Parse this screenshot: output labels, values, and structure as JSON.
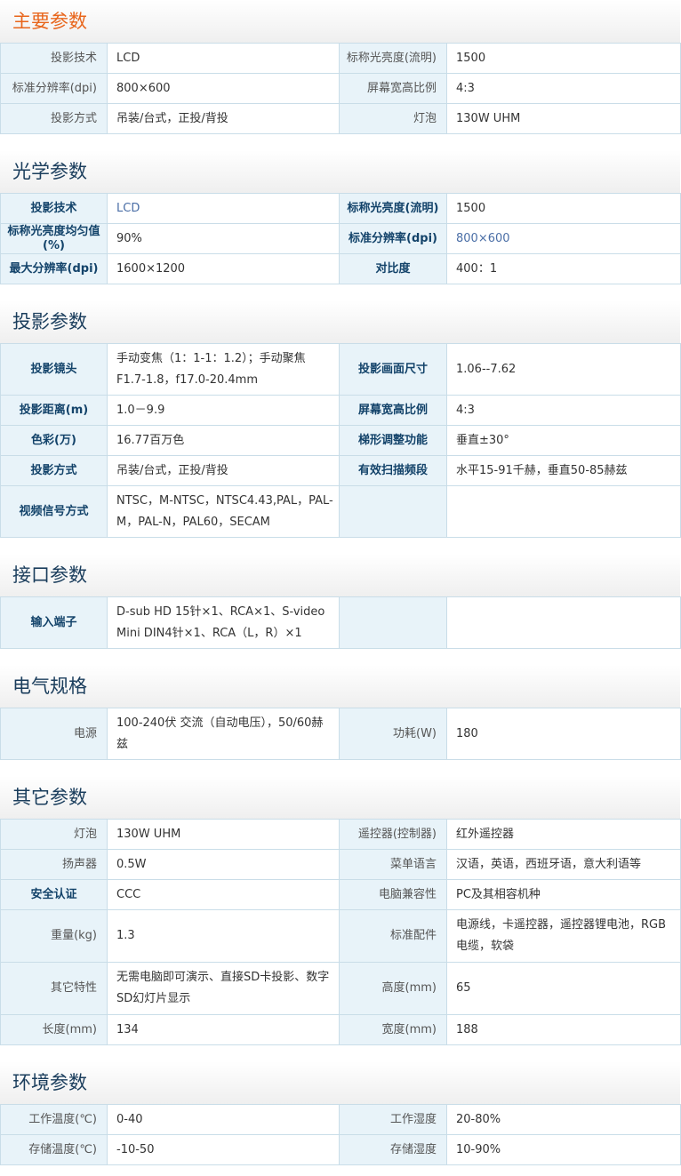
{
  "sections": {
    "main": {
      "title": "主要参数",
      "rows": [
        [
          "投影技术",
          "LCD",
          "标称光亮度(流明)",
          "1500"
        ],
        [
          "标准分辨率(dpi)",
          "800×600",
          "屏幕宽高比例",
          "4:3"
        ],
        [
          "投影方式",
          "吊装/台式，正投/背投",
          "灯泡",
          "130W UHM"
        ]
      ]
    },
    "optics": {
      "title": "光学参数",
      "rows": [
        [
          "投影技术",
          "LCD",
          "标称光亮度(流明)",
          "1500"
        ],
        [
          "标称光亮度均匀值(%)",
          "90%",
          "标准分辨率(dpi)",
          "800×600"
        ],
        [
          "最大分辨率(dpi)",
          "1600×1200",
          "对比度",
          "400：1"
        ]
      ]
    },
    "projection": {
      "title": "投影参数",
      "rows": [
        [
          "投影镜头",
          "手动变焦（1：1-1：1.2）；手动聚焦F1.7-1.8，f17.0-20.4mm",
          "投影画面尺寸",
          "1.06--7.62"
        ],
        [
          "投影距离(m)",
          "1.0－9.9",
          "屏幕宽高比例",
          "4:3"
        ],
        [
          "色彩(万)",
          "16.77百万色",
          "梯形调整功能",
          "垂直±30°"
        ],
        [
          "投影方式",
          "吊装/台式，正投/背投",
          "有效扫描频段",
          "水平15-91千赫，垂直50-85赫兹"
        ],
        [
          "视频信号方式",
          "NTSC，M-NTSC，NTSC4.43,PAL，PAL-M，PAL-N，PAL60，SECAM",
          "",
          ""
        ]
      ]
    },
    "interface": {
      "title": "接口参数",
      "rows": [
        [
          "输入端子",
          "D-sub HD 15针×1、RCA×1、S-video Mini DIN4针×1、RCA（L，R）×1",
          "",
          ""
        ]
      ]
    },
    "electrical": {
      "title": "电气规格",
      "rows": [
        [
          "电源",
          "100-240伏 交流（自动电压），50/60赫兹",
          "功耗(W)",
          "180"
        ]
      ]
    },
    "other": {
      "title": "其它参数",
      "rows": [
        [
          "灯泡",
          "130W UHM",
          "遥控器(控制器)",
          "红外遥控器"
        ],
        [
          "扬声器",
          "0.5W",
          "菜单语言",
          "汉语，英语，西班牙语，意大利语等"
        ],
        [
          "安全认证",
          "CCC",
          "电脑兼容性",
          "PC及其相容机种"
        ],
        [
          "重量(kg)",
          "1.3",
          "标准配件",
          "电源线，卡遥控器，遥控器锂电池，RGB电缆，软袋"
        ],
        [
          "其它特性",
          "无需电脑即可演示、直接SD卡投影、数字SD幻灯片显示",
          "高度(mm)",
          "65"
        ],
        [
          "长度(mm)",
          "134",
          "宽度(mm)",
          "188"
        ]
      ]
    },
    "environment": {
      "title": "环境参数",
      "rows": [
        [
          "工作温度(℃)",
          "0-40",
          "工作湿度",
          "20-80%"
        ],
        [
          "存储温度(℃)",
          "-10-50",
          "存储湿度",
          "10-90%"
        ]
      ]
    }
  },
  "colors": {
    "main_title": "#e8651b",
    "section_title": "#1a3d5c",
    "label_bg": "#e8f3f9",
    "border": "#c9dde8",
    "bold_label": "#13436a",
    "blue_value": "#4a6ea6"
  }
}
